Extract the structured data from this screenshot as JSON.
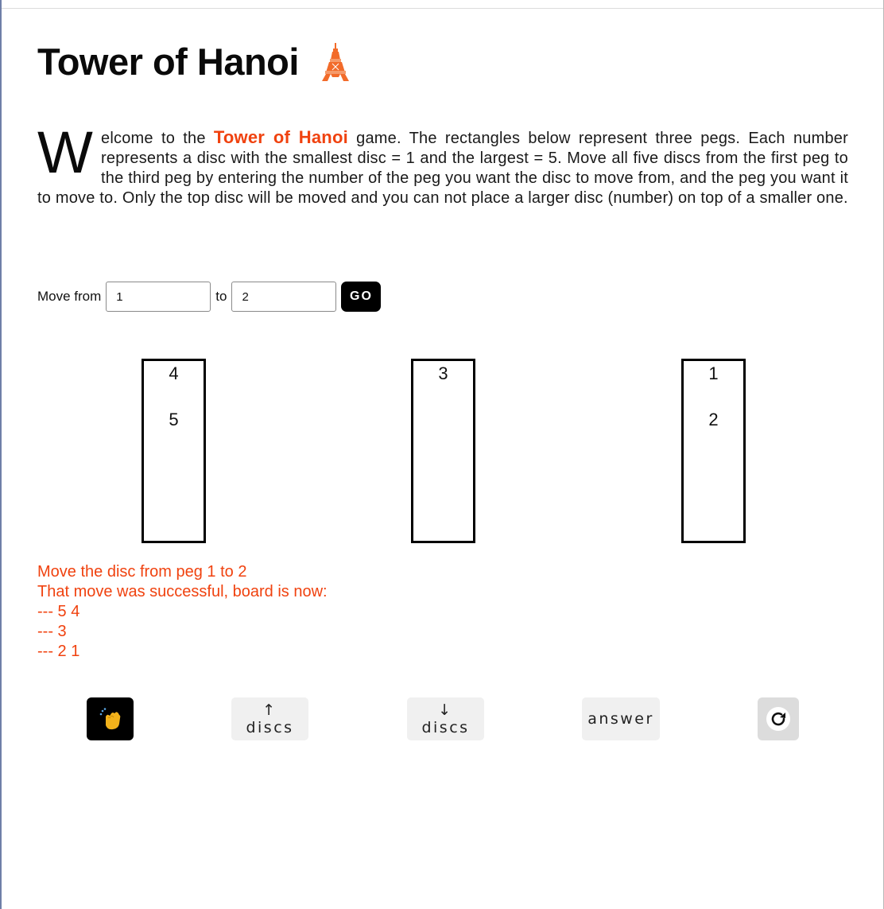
{
  "title": "Tower of Hanoi",
  "intro": {
    "dropcap": "W",
    "part1": "elcome to the ",
    "brand": "Tower of Hanoi",
    "part2": " game. The rectangles below represent three pegs. Each number represents a disc with the smallest disc = 1 and the largest = 5. Move all five discs from the first peg to the third peg by entering the number of the peg you want the disc to move from, and the peg you want it to move to. Only the top disc will be moved and you can not place a larger disc (number) on top of a smaller one."
  },
  "move_form": {
    "from_label": "Move from",
    "from_value": "1",
    "to_label": "to",
    "to_value": "2",
    "go_label": "GO"
  },
  "pegs": [
    {
      "discs": [
        "4",
        "5"
      ]
    },
    {
      "discs": [
        "3"
      ]
    },
    {
      "discs": [
        "1",
        "2"
      ]
    }
  ],
  "status": {
    "lines": [
      "Move the disc from peg 1 to 2",
      "That move was successful, board is now:",
      "--- 5 4",
      "--- 3",
      "--- 2 1"
    ]
  },
  "buttons": {
    "clap_icon": "clapping-hands-icon",
    "more_discs": "↑ discs",
    "fewer_discs": "↓ discs",
    "answer": "answer",
    "reset_icon": "reset-icon"
  },
  "colors": {
    "accent": "#f0420f",
    "peg_border": "#000000",
    "button_bg": "#f0f0f0"
  }
}
